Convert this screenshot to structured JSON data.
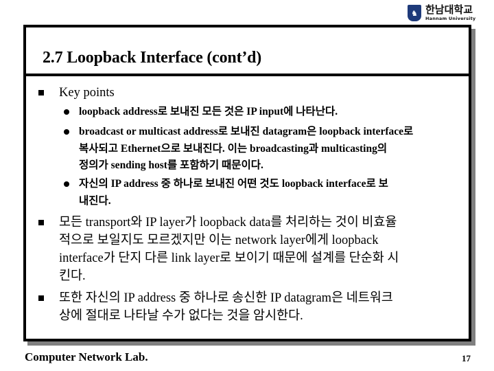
{
  "logo": {
    "korean_name": "한남대학교",
    "english_name": "Hannam University",
    "emblem_icon": "university-emblem-icon"
  },
  "slide": {
    "title": "2.7 Loopback Interface (cont’d)",
    "bullets": [
      {
        "text": "Key points",
        "sub_bullets": [
          {
            "text": "loopback address로 보내진 모든 것은 IP input에 나타난다."
          },
          {
            "text_lines": [
              "broadcast or multicast address로 보내진 datagram은 loopback interface로",
              "복사되고 Ethernet으로 보내진다. 이는 broadcasting과 multicasting의",
              "정의가 sending host를 포함하기 때문이다."
            ]
          },
          {
            "text_lines": [
              "자신의 IP address 중 하나로 보내진 어떤 것도 loopback interface로 보",
              "내진다."
            ]
          }
        ]
      },
      {
        "text_lines": [
          "모든 transport와 IP layer가 loopback data를 처리하는 것이 비효율",
          "적으로 보일지도 모르겠지만 이는 network layer에게 loopback",
          "interface가 단지 다른 link layer로 보이기 때문에 설계를 단순화 시",
          "킨다."
        ]
      },
      {
        "text_lines": [
          "또한 자신의 IP address 중 하나로 송신한 IP datagram은 네트워크",
          "상에 절대로 나타날 수가 없다는 것을 암시한다."
        ]
      }
    ]
  },
  "footer": {
    "lab_name": "Computer Network Lab.",
    "page_number": "17"
  }
}
